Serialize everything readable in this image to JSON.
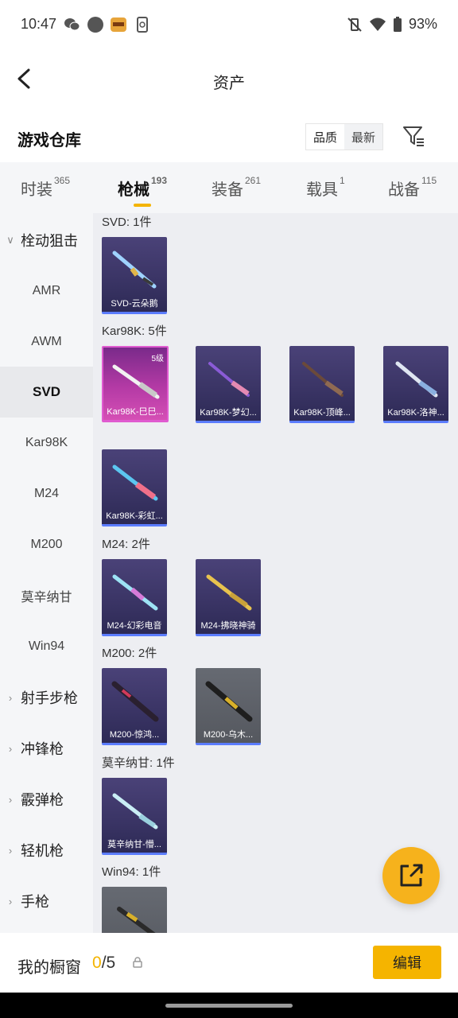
{
  "status": {
    "time": "10:47",
    "battery": "93%"
  },
  "header": {
    "title": "资产"
  },
  "warehouse": {
    "title": "游戏仓库",
    "sort_quality": "品质",
    "sort_newest": "最新"
  },
  "tabs": [
    {
      "label": "时装",
      "count": "365"
    },
    {
      "label": "枪械",
      "count": "193"
    },
    {
      "label": "装备",
      "count": "261"
    },
    {
      "label": "载具",
      "count": "1"
    },
    {
      "label": "战备",
      "count": "115"
    }
  ],
  "sidebar": {
    "group_bolt": "栓动狙击",
    "items": [
      "AMR",
      "AWM",
      "SVD",
      "Kar98K",
      "M24",
      "M200",
      "莫辛纳甘",
      "Win94"
    ],
    "groups": [
      "射手步枪",
      "冲锋枪",
      "霰弹枪",
      "轻机枪",
      "手枪"
    ]
  },
  "sections": [
    {
      "title": "SVD: 1件",
      "items": [
        {
          "label": "SVD-云朵鹅"
        }
      ]
    },
    {
      "title": "Kar98K: 5件",
      "items": [
        {
          "label": "Kar98K-巳巳...",
          "level": "5级"
        },
        {
          "label": "Kar98K-梦幻..."
        },
        {
          "label": "Kar98K-顶峰..."
        },
        {
          "label": "Kar98K-洛神..."
        },
        {
          "label": "Kar98K-彩虹..."
        }
      ]
    },
    {
      "title": "M24: 2件",
      "items": [
        {
          "label": "M24-幻彩电音"
        },
        {
          "label": "M24-拂晓神骑"
        }
      ]
    },
    {
      "title": "M200: 2件",
      "items": [
        {
          "label": "M200-惊鸿..."
        },
        {
          "label": "M200-乌木..."
        }
      ]
    },
    {
      "title": "莫辛纳甘: 1件",
      "items": [
        {
          "label": "莫辛纳甘-懵..."
        }
      ]
    },
    {
      "title": "Win94: 1件",
      "items": []
    }
  ],
  "showcase": {
    "label": "我的橱窗",
    "current": "0",
    "total": "/5",
    "edit": "编辑"
  },
  "colors": {
    "accent": "#f5b400",
    "card": "#3b3566",
    "card_border": "#5b7cff",
    "highlight": "#d54fb5"
  }
}
